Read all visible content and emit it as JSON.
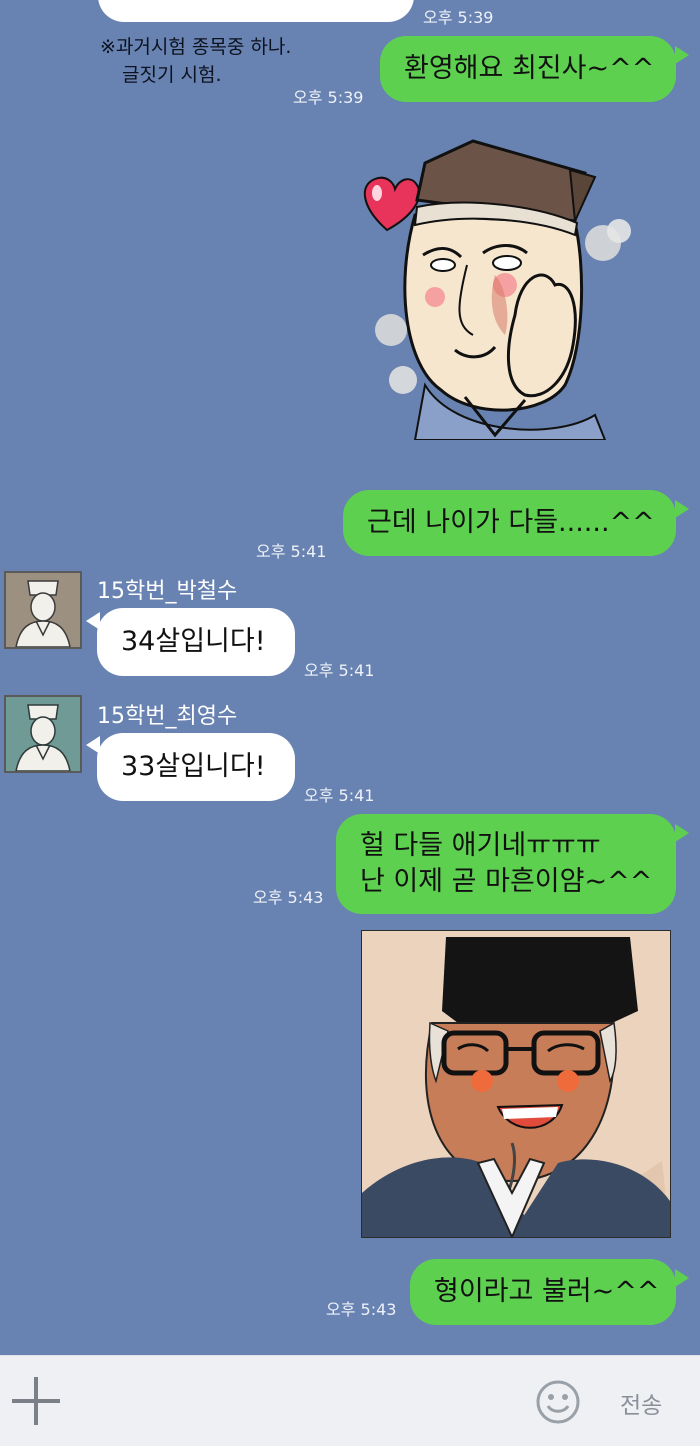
{
  "colors": {
    "background": "#6883b1",
    "outgoing_bubble": "#5dd14f",
    "incoming_bubble": "#ffffff"
  },
  "messages": {
    "top_time": "오후 5:39",
    "note_lines": [
      "※과거시험 종목중 하나.",
      "글짓기 시험."
    ],
    "m1": {
      "text": "환영해요 최진사~^^",
      "time": "오후 5:39"
    },
    "m2": {
      "text": "근데 나이가 다들......^^",
      "time": "오후 5:41"
    },
    "m3": {
      "sender": "15학번_박철수",
      "text": "34살입니다!",
      "time": "오후 5:41"
    },
    "m4": {
      "sender": "15학번_최영수",
      "text": "33살입니다!",
      "time": "오후 5:41"
    },
    "m5": {
      "lines": [
        "헐 다들 애기네ㅠㅠㅠ",
        "난 이제 곧 마흔이얌~^^"
      ],
      "time": "오후 5:43"
    },
    "m6": {
      "text": "형이라고 불러~^^",
      "time": "오후 5:43"
    }
  },
  "input_bar": {
    "plus_icon": "plus-icon",
    "emoji_icon": "smiley-icon",
    "send_label": "전송"
  }
}
